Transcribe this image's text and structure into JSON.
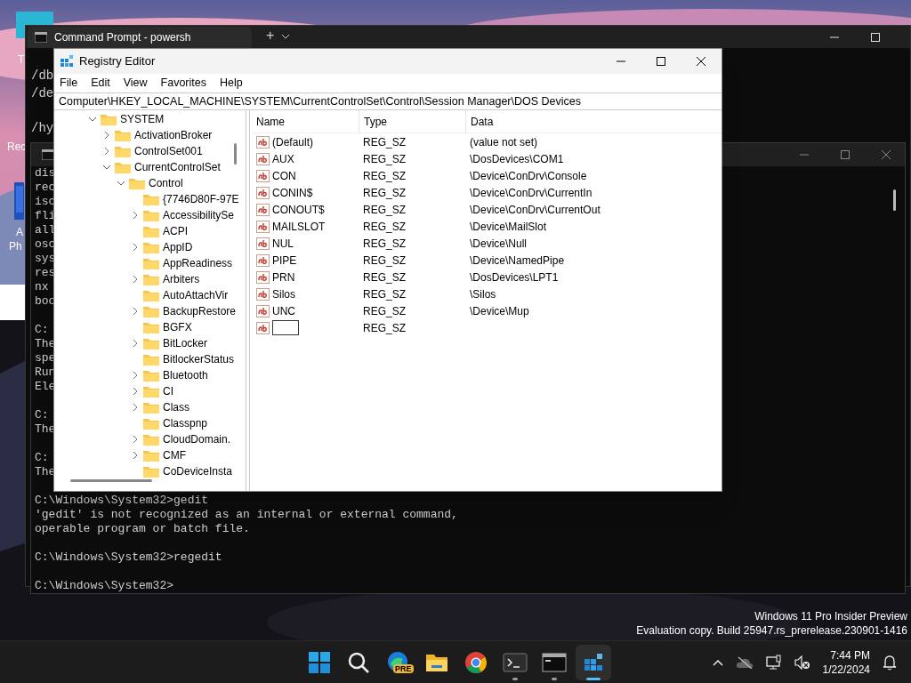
{
  "desktop": {
    "icons": [
      {
        "label": "T"
      },
      {
        "label": "Rec"
      },
      {
        "label": "A"
      },
      {
        "label": "Ph"
      }
    ],
    "watermark": [
      "Windows 11 Pro Insider Preview",
      "Evaluation copy. Build 25947.rs_prerelease.230901-1416"
    ]
  },
  "terminal": {
    "tab_title": "Command Prompt - powersh",
    "new_tab": "+",
    "blocks": [
      [
        "/db",
        "/de"
      ],
      [
        "/hy"
      ]
    ]
  },
  "command_prompt": {
    "blocks": [
      [
        "dis",
        "rec",
        "isc",
        "fli",
        "all",
        "osc",
        "sys",
        "res",
        "nx",
        "boo"
      ],
      [
        "C:",
        "The",
        "spe",
        "Run",
        "Ele"
      ],
      [
        "C:",
        "The"
      ],
      [
        "C:",
        "The"
      ],
      [
        "C:\\Windows\\System32>gedit",
        "'gedit' is not recognized as an internal or external command,",
        "operable program or batch file."
      ],
      [
        "C:\\Windows\\System32>regedit"
      ],
      [
        "C:\\Windows\\System32>"
      ]
    ]
  },
  "registry_editor": {
    "title": "Registry Editor",
    "menu": [
      "File",
      "Edit",
      "View",
      "Favorites",
      "Help"
    ],
    "address": "Computer\\HKEY_LOCAL_MACHINE\\SYSTEM\\CurrentControlSet\\Control\\Session Manager\\DOS Devices",
    "tree": [
      {
        "label": "SYSTEM",
        "expanded": true,
        "children": [
          {
            "label": "ActivationBroker",
            "expanded": false
          },
          {
            "label": "ControlSet001",
            "expanded": false
          },
          {
            "label": "CurrentControlSet",
            "expanded": true,
            "children": [
              {
                "label": "Control",
                "expanded": true,
                "children": [
                  {
                    "label": "{7746D80F-97E",
                    "kind": "leaf"
                  },
                  {
                    "label": "AccessibilitySe",
                    "expanded": false
                  },
                  {
                    "label": "ACPI",
                    "kind": "leaf"
                  },
                  {
                    "label": "AppID",
                    "expanded": false
                  },
                  {
                    "label": "AppReadiness",
                    "kind": "leaf"
                  },
                  {
                    "label": "Arbiters",
                    "expanded": false
                  },
                  {
                    "label": "AutoAttachVir",
                    "kind": "leaf"
                  },
                  {
                    "label": "BackupRestore",
                    "expanded": false
                  },
                  {
                    "label": "BGFX",
                    "kind": "leaf"
                  },
                  {
                    "label": "BitLocker",
                    "expanded": false
                  },
                  {
                    "label": "BitlockerStatus",
                    "kind": "leaf"
                  },
                  {
                    "label": "Bluetooth",
                    "expanded": false
                  },
                  {
                    "label": "CI",
                    "expanded": false
                  },
                  {
                    "label": "Class",
                    "expanded": false
                  },
                  {
                    "label": "Classpnp",
                    "kind": "leaf"
                  },
                  {
                    "label": "CloudDomain.",
                    "expanded": false
                  },
                  {
                    "label": "CMF",
                    "expanded": false
                  },
                  {
                    "label": "CoDeviceInsta",
                    "kind": "leaf"
                  }
                ]
              }
            ]
          }
        ]
      }
    ],
    "columns": [
      "Name",
      "Type",
      "Data"
    ],
    "rows": [
      {
        "kind": "value",
        "name": "(Default)",
        "type": "REG_SZ",
        "data": "(value not set)"
      },
      {
        "kind": "value",
        "name": "AUX",
        "type": "REG_SZ",
        "data": "\\DosDevices\\COM1"
      },
      {
        "kind": "value",
        "name": "CON",
        "type": "REG_SZ",
        "data": "\\Device\\ConDrv\\Console"
      },
      {
        "kind": "value",
        "name": "CONIN$",
        "type": "REG_SZ",
        "data": "\\Device\\ConDrv\\CurrentIn"
      },
      {
        "kind": "value",
        "name": "CONOUT$",
        "type": "REG_SZ",
        "data": "\\Device\\ConDrv\\CurrentOut"
      },
      {
        "kind": "value",
        "name": "MAILSLOT",
        "type": "REG_SZ",
        "data": "\\Device\\MailSlot"
      },
      {
        "kind": "value",
        "name": "NUL",
        "type": "REG_SZ",
        "data": "\\Device\\Null"
      },
      {
        "kind": "value",
        "name": "PIPE",
        "type": "REG_SZ",
        "data": "\\Device\\NamedPipe"
      },
      {
        "kind": "value",
        "name": "PRN",
        "type": "REG_SZ",
        "data": "\\DosDevices\\LPT1"
      },
      {
        "kind": "value",
        "name": "Silos",
        "type": "REG_SZ",
        "data": "\\Silos"
      },
      {
        "kind": "value",
        "name": "UNC",
        "type": "REG_SZ",
        "data": "\\Device\\Mup"
      },
      {
        "kind": "editing",
        "type": "REG_SZ"
      }
    ]
  },
  "taskbar": {
    "apps": [
      {
        "kind": "start",
        "running": false,
        "selected": false
      },
      {
        "kind": "search",
        "running": false,
        "selected": false
      },
      {
        "kind": "edge",
        "badge": "PRE",
        "running": false,
        "selected": false
      },
      {
        "kind": "explorer",
        "running": false,
        "selected": false
      },
      {
        "kind": "chrome",
        "running": false,
        "selected": false
      },
      {
        "kind": "terminal",
        "running": true,
        "selected": false
      },
      {
        "kind": "cmd",
        "running": true,
        "selected": false
      },
      {
        "kind": "regedit",
        "running": true,
        "selected": true
      }
    ],
    "time": "7:44 PM",
    "date": "1/22/2024"
  }
}
